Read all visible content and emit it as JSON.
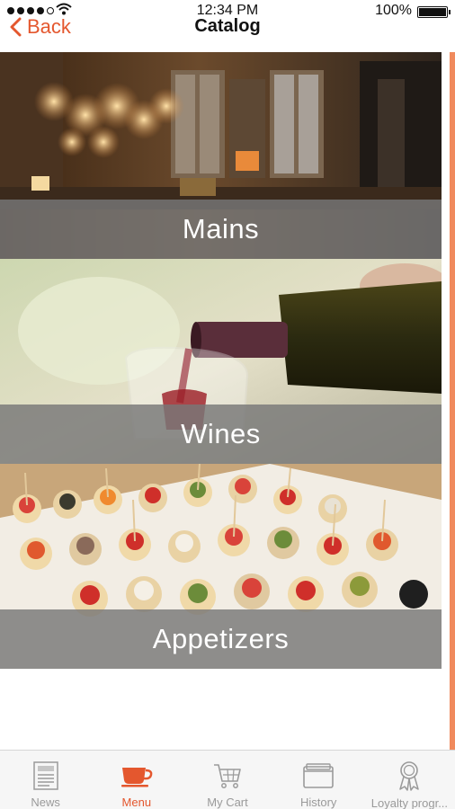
{
  "status_bar": {
    "time": "12:34 PM",
    "battery_text": "100%"
  },
  "nav": {
    "back_label": "Back",
    "title": "Catalog"
  },
  "catalog": {
    "items": [
      {
        "label": "Mains"
      },
      {
        "label": "Wines"
      },
      {
        "label": "Appetizers"
      }
    ]
  },
  "tabs": [
    {
      "label": "News",
      "icon": "newspaper-icon",
      "active": false
    },
    {
      "label": "Menu",
      "icon": "cup-icon",
      "active": true
    },
    {
      "label": "My Cart",
      "icon": "cart-icon",
      "active": false
    },
    {
      "label": "History",
      "icon": "folder-icon",
      "active": false
    },
    {
      "label": "Loyalty progr...",
      "icon": "award-ribbon-icon",
      "active": false
    }
  ],
  "colors": {
    "accent": "#e4572e",
    "caption_band": "#787878",
    "tab_inactive": "#9a9a9a",
    "scroll_accent": "#f08a5d"
  }
}
